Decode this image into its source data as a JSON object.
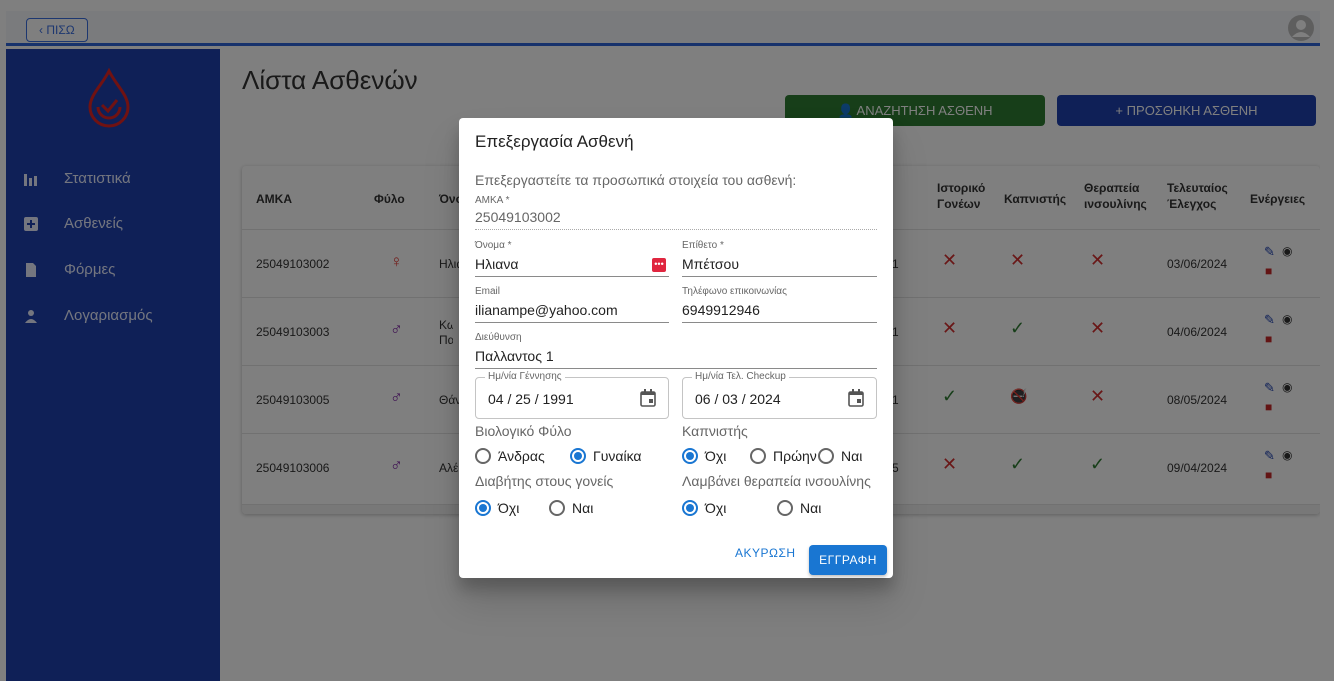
{
  "topbar": {
    "back_label": "‹ ΠΙΣΩ"
  },
  "sidebar": {
    "items": [
      {
        "label": "Στατιστικά",
        "icon": "bar-chart-icon"
      },
      {
        "label": "Ασθενείς",
        "icon": "plus-box-icon"
      },
      {
        "label": "Φόρμες",
        "icon": "document-icon"
      },
      {
        "label": "Λογαριασμός",
        "icon": "person-icon"
      }
    ]
  },
  "main": {
    "title": "Λίστα Ασθενών",
    "search_button": "ΑΝΑΖΗΤΗΣΗ ΑΣΘΕΝΗ",
    "add_button": "ΠΡΟΣΘΗΚΗ ΑΣΘΕΝΗ"
  },
  "table": {
    "headers": {
      "amka": "ΑΜΚΑ",
      "gender": "Φύλο",
      "name": "Όνο",
      "history": "Ιστορικό Γονέων",
      "smoker": "Καπνιστής",
      "insulin": "Θεραπεία ινσουλίνης",
      "last_check": "Τελευταίος Έλεγχος",
      "actions": "Ενέργειες"
    },
    "rows": [
      {
        "amka": "25049103002",
        "name": "Ηλια",
        "col": "1",
        "history": "✕",
        "smoker": "✕",
        "insulin": "✕",
        "last_check": "03/06/2024"
      },
      {
        "amka": "25049103003",
        "name": "Κων Παλ",
        "col": "1",
        "history": "✕",
        "smoker": "✓",
        "insulin": "✕",
        "last_check": "04/06/2024"
      },
      {
        "amka": "25049103005",
        "name": "Θάν",
        "col": "1",
        "history": "✓",
        "smoker": "🚭",
        "insulin": "✕",
        "last_check": "08/05/2024"
      },
      {
        "amka": "25049103006",
        "name": "Αλέ",
        "col": "5",
        "history": "✕",
        "smoker": "✓",
        "insulin": "✓",
        "last_check": "09/04/2024"
      }
    ]
  },
  "dialog": {
    "title": "Επεξεργασία Ασθενή",
    "subtitle": "Επεξεργαστείτε τα προσωπικά στοιχεία του ασθενή:",
    "amka_label": "ΑΜΚΑ *",
    "amka_value": "25049103002",
    "name_label": "Όνομα *",
    "name_value": "Ηλιανα",
    "surname_label": "Επίθετο *",
    "surname_value": "Μπέτσου",
    "email_label": "Email",
    "email_value": "ilianampe@yahoo.com",
    "phone_label": "Τηλέφωνο επικοινωνίας",
    "phone_value": "6949912946",
    "address_label": "Διεύθυνση",
    "address_value": "Παλλαντος 1",
    "birth_label": "Ημ/νία Γέννησης",
    "birth_value": "04 / 25 / 1991",
    "checkup_label": "Ημ/νία Τελ. Checkup",
    "checkup_value": "06 / 03 / 2024",
    "sex_label": "Βιολογικό Φύλο",
    "sex_male": "Άνδρας",
    "sex_female": "Γυναίκα",
    "smoker_label": "Καπνιστής",
    "smoker_no": "Όχι",
    "smoker_former": "Πρώην",
    "smoker_yes": "Ναι",
    "parents_label": "Διαβήτης στους γονείς",
    "parents_no": "Όχι",
    "parents_yes": "Ναι",
    "insulin_label": "Λαμβάνει θεραπεία ινσουλίνης",
    "insulin_no": "Όχι",
    "insulin_yes": "Ναι",
    "cancel": "ΑΚΥΡΩΣΗ",
    "save": "ΕΓΓΡΑΦΗ"
  },
  "colors": {
    "primary": "#1e40af",
    "accent": "#1976d2",
    "success": "#2e7d32",
    "error": "#d32f2f"
  }
}
